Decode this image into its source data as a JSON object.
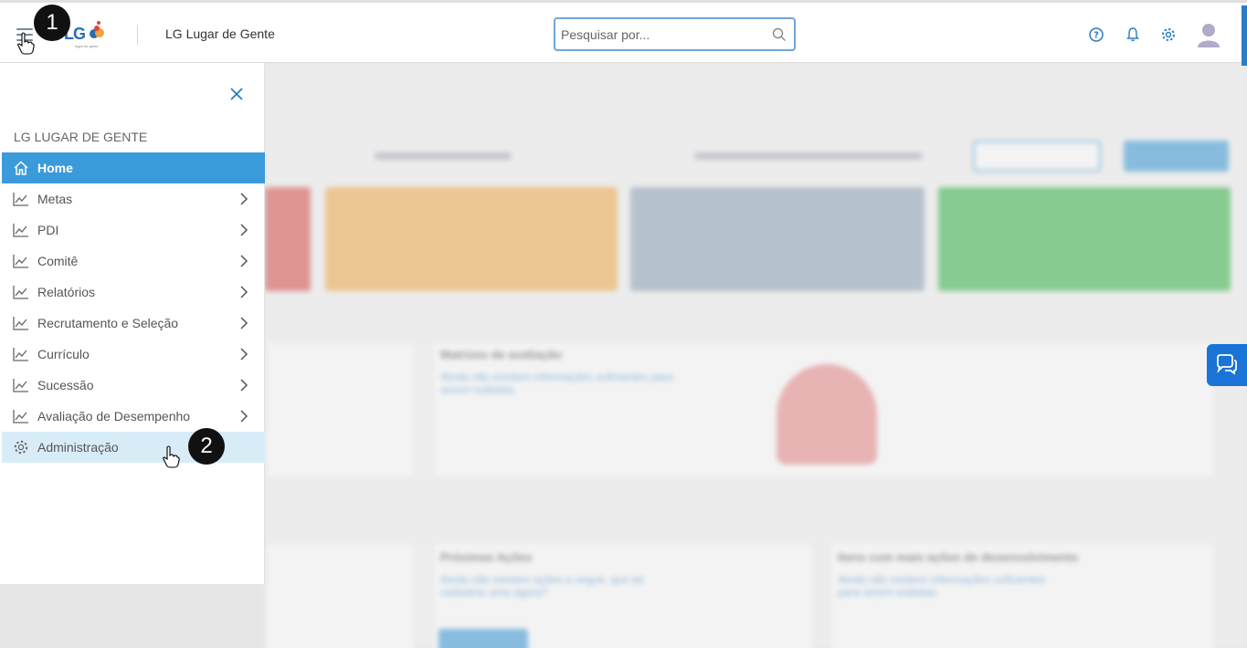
{
  "header": {
    "logo_text": "LG",
    "logo_sub": "lugar de gente",
    "app_title": "LG Lugar de Gente",
    "search_placeholder": "Pesquisar por..."
  },
  "sidebar": {
    "heading": "LG LUGAR DE GENTE",
    "items": [
      {
        "label": "Home",
        "icon": "home-icon"
      },
      {
        "label": "Metas",
        "icon": "chart-line-icon"
      },
      {
        "label": "PDI",
        "icon": "chart-line-icon"
      },
      {
        "label": "Comitê",
        "icon": "chart-line-icon"
      },
      {
        "label": "Relatórios",
        "icon": "chart-line-icon"
      },
      {
        "label": "Recrutamento e Seleção",
        "icon": "chart-line-icon"
      },
      {
        "label": "Currículo",
        "icon": "chart-line-icon"
      },
      {
        "label": "Sucessão",
        "icon": "chart-line-icon"
      },
      {
        "label": "Avaliação de Desempenho",
        "icon": "chart-line-icon"
      },
      {
        "label": "Administração",
        "icon": "gear-icon"
      }
    ]
  },
  "steps": {
    "one": "1",
    "two": "2"
  },
  "background": {
    "matrices_title": "Matrizes de avaliação",
    "matrices_text": "Ainda não existem informações suficientes para serem exibidas.",
    "actions_title": "Próximas Ações",
    "actions_text": "Ainda não existem ações a seguir, que tal cadastrar uma agora?",
    "items_title": "Itens com mais ações de desenvolvimento",
    "items_text": "Ainda não existem informações suficientes para serem exibidas."
  },
  "colors": {
    "accent": "#3b9bda",
    "hover": "#d8ecf8",
    "card_red": "#d9534f",
    "card_yellow": "#f0ad4e",
    "card_gray": "#8ea4b8",
    "card_green": "#3cb54a"
  }
}
